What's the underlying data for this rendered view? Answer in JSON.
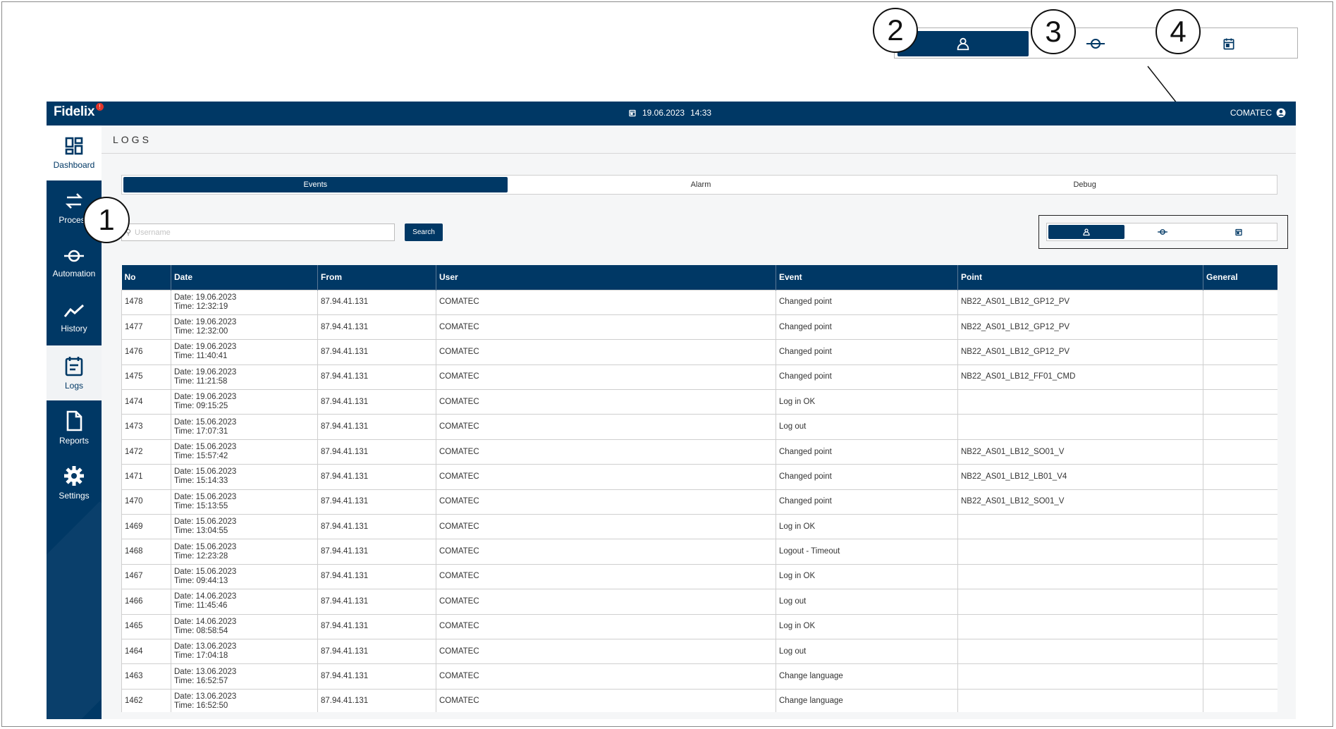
{
  "header": {
    "logo_text": "Fidelix",
    "logo_badge": "!",
    "date": "19.06.2023",
    "time": "14:33",
    "user": "COMATEC"
  },
  "sidebar": {
    "items": [
      {
        "label": "Dashboard",
        "icon": "dashboard-icon"
      },
      {
        "label": "Process",
        "icon": "process-icon"
      },
      {
        "label": "Automation",
        "icon": "automation-icon"
      },
      {
        "label": "History",
        "icon": "history-icon"
      },
      {
        "label": "Logs",
        "icon": "logs-icon"
      },
      {
        "label": "Reports",
        "icon": "reports-icon"
      },
      {
        "label": "Settings",
        "icon": "settings-icon"
      }
    ]
  },
  "page": {
    "title": "LOGS"
  },
  "tabs": [
    {
      "label": "Events",
      "active": true
    },
    {
      "label": "Alarm",
      "active": false
    },
    {
      "label": "Debug",
      "active": false
    }
  ],
  "search": {
    "placeholder": "Username",
    "value": "",
    "button_label": "Search"
  },
  "view_switch": {
    "options": [
      "user-icon",
      "point-icon",
      "calendar-icon"
    ],
    "selected": "user-icon"
  },
  "callouts": {
    "c1": "1",
    "c2": "2",
    "c3": "3",
    "c4": "4"
  },
  "colors": {
    "primary": "#003865",
    "background": "#f5f6f7"
  },
  "table": {
    "columns": [
      "No",
      "Date",
      "From",
      "User",
      "Event",
      "Point",
      "General"
    ],
    "rows": [
      {
        "no": "1478",
        "date": "Date: 19.06.2023",
        "time": "Time: 12:32:19",
        "from": "87.94.41.131",
        "user": "COMATEC",
        "event": "Changed point",
        "point": "NB22_AS01_LB12_GP12_PV",
        "general": ""
      },
      {
        "no": "1477",
        "date": "Date: 19.06.2023",
        "time": "Time: 12:32:00",
        "from": "87.94.41.131",
        "user": "COMATEC",
        "event": "Changed point",
        "point": "NB22_AS01_LB12_GP12_PV",
        "general": ""
      },
      {
        "no": "1476",
        "date": "Date: 19.06.2023",
        "time": "Time: 11:40:41",
        "from": "87.94.41.131",
        "user": "COMATEC",
        "event": "Changed point",
        "point": "NB22_AS01_LB12_GP12_PV",
        "general": ""
      },
      {
        "no": "1475",
        "date": "Date: 19.06.2023",
        "time": "Time: 11:21:58",
        "from": "87.94.41.131",
        "user": "COMATEC",
        "event": "Changed point",
        "point": "NB22_AS01_LB12_FF01_CMD",
        "general": ""
      },
      {
        "no": "1474",
        "date": "Date: 19.06.2023",
        "time": "Time: 09:15:25",
        "from": "87.94.41.131",
        "user": "COMATEC",
        "event": "Log in OK",
        "point": "",
        "general": ""
      },
      {
        "no": "1473",
        "date": "Date: 15.06.2023",
        "time": "Time: 17:07:31",
        "from": "87.94.41.131",
        "user": "COMATEC",
        "event": "Log out",
        "point": "",
        "general": ""
      },
      {
        "no": "1472",
        "date": "Date: 15.06.2023",
        "time": "Time: 15:57:42",
        "from": "87.94.41.131",
        "user": "COMATEC",
        "event": "Changed point",
        "point": "NB22_AS01_LB12_SO01_V",
        "general": ""
      },
      {
        "no": "1471",
        "date": "Date: 15.06.2023",
        "time": "Time: 15:14:33",
        "from": "87.94.41.131",
        "user": "COMATEC",
        "event": "Changed point",
        "point": "NB22_AS01_LB12_LB01_V4",
        "general": ""
      },
      {
        "no": "1470",
        "date": "Date: 15.06.2023",
        "time": "Time: 15:13:55",
        "from": "87.94.41.131",
        "user": "COMATEC",
        "event": "Changed point",
        "point": "NB22_AS01_LB12_SO01_V",
        "general": ""
      },
      {
        "no": "1469",
        "date": "Date: 15.06.2023",
        "time": "Time: 13:04:55",
        "from": "87.94.41.131",
        "user": "COMATEC",
        "event": "Log in OK",
        "point": "",
        "general": ""
      },
      {
        "no": "1468",
        "date": "Date: 15.06.2023",
        "time": "Time: 12:23:28",
        "from": "87.94.41.131",
        "user": "COMATEC",
        "event": "Logout - Timeout",
        "point": "",
        "general": ""
      },
      {
        "no": "1467",
        "date": "Date: 15.06.2023",
        "time": "Time: 09:44:13",
        "from": "87.94.41.131",
        "user": "COMATEC",
        "event": "Log in OK",
        "point": "",
        "general": ""
      },
      {
        "no": "1466",
        "date": "Date: 14.06.2023",
        "time": "Time: 11:45:46",
        "from": "87.94.41.131",
        "user": "COMATEC",
        "event": "Log out",
        "point": "",
        "general": ""
      },
      {
        "no": "1465",
        "date": "Date: 14.06.2023",
        "time": "Time: 08:58:54",
        "from": "87.94.41.131",
        "user": "COMATEC",
        "event": "Log in OK",
        "point": "",
        "general": ""
      },
      {
        "no": "1464",
        "date": "Date: 13.06.2023",
        "time": "Time: 17:04:18",
        "from": "87.94.41.131",
        "user": "COMATEC",
        "event": "Log out",
        "point": "",
        "general": ""
      },
      {
        "no": "1463",
        "date": "Date: 13.06.2023",
        "time": "Time: 16:52:57",
        "from": "87.94.41.131",
        "user": "COMATEC",
        "event": "Change language",
        "point": "",
        "general": ""
      },
      {
        "no": "1462",
        "date": "Date: 13.06.2023",
        "time": "Time: 16:52:50",
        "from": "87.94.41.131",
        "user": "COMATEC",
        "event": "Change language",
        "point": "",
        "general": ""
      }
    ]
  }
}
